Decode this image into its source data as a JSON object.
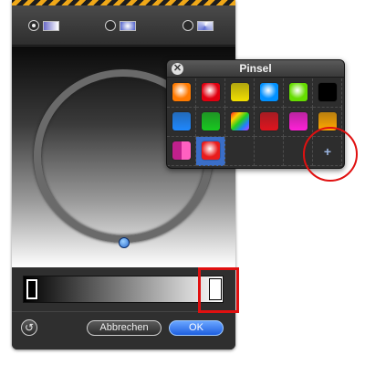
{
  "gradient_types": [
    {
      "name": "linear",
      "selected": true
    },
    {
      "name": "radial",
      "selected": false
    },
    {
      "name": "angle",
      "selected": false
    }
  ],
  "gradient_preview": {
    "start_color": "#000000",
    "end_color": "#ffffff"
  },
  "gradient_stops": [
    {
      "color": "#000000"
    },
    {
      "color": "#ffffff"
    }
  ],
  "footer": {
    "reset_icon": "↺",
    "cancel_label": "Abbrechen",
    "ok_label": "OK"
  },
  "brush_popup": {
    "title": "Pinsel",
    "close_icon": "✕",
    "add_icon": "+",
    "swatches": [
      {
        "color": "#ff7a00",
        "style": "radial"
      },
      {
        "color": "#e00010",
        "style": "radial"
      },
      {
        "color": "#f2e000",
        "style": "linear"
      },
      {
        "color": "#0090ff",
        "style": "radial"
      },
      {
        "color": "#66dd00",
        "style": "radial"
      },
      {
        "color": "#000000",
        "style": "solid"
      },
      {
        "color": "#1e88ff",
        "style": "linear"
      },
      {
        "color": "#18c820",
        "style": "linear"
      },
      {
        "color": "#c040ff",
        "style": "rainbow"
      },
      {
        "color": "#e0141e",
        "style": "linear"
      },
      {
        "color": "#ff20d8",
        "style": "linear"
      },
      {
        "color": "#ffa800",
        "style": "linear"
      },
      {
        "color": "#c0208c",
        "style": "split"
      },
      {
        "color": "#e81c1c",
        "style": "radial"
      }
    ],
    "selected_index": 13
  },
  "accent_colors": {
    "ok_button": "#2a6ee8",
    "highlight": "#e01010"
  }
}
